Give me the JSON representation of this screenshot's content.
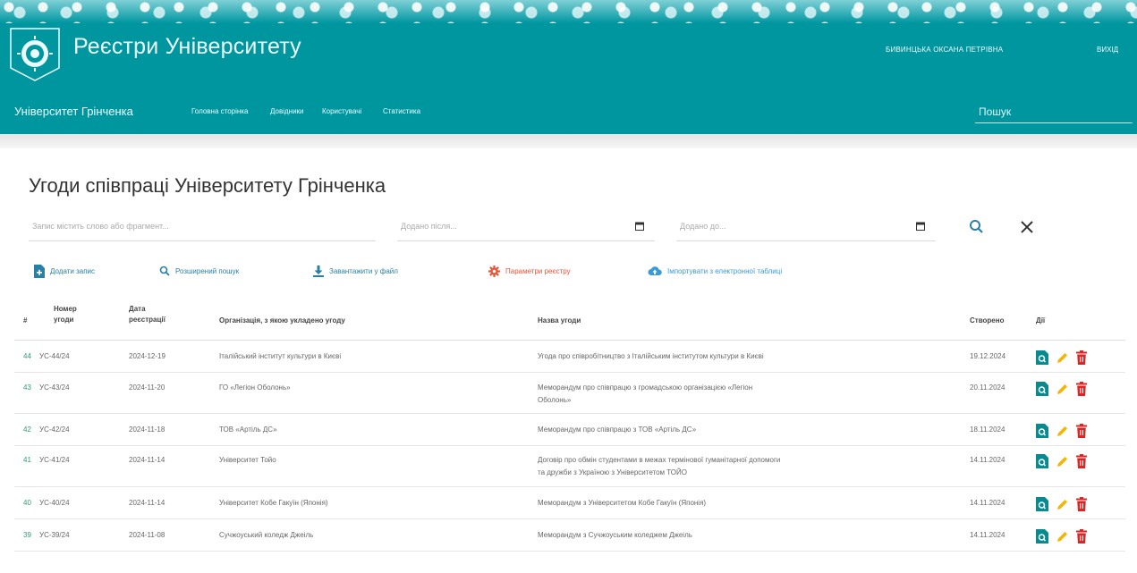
{
  "header": {
    "app_title": "Реєстри Університету",
    "user_name": "БИВИНЦЬКА ОКСАНА ПЕТРІВНА",
    "logout_label": "ВИХІД"
  },
  "nav": {
    "brand": "Університет Грінченка",
    "links": [
      "Головна сторінка",
      "Довідники",
      "Користувачі",
      "Статистика"
    ],
    "search_placeholder": "Пошук"
  },
  "page": {
    "title": "Угоди співпраці Університету Грінченка"
  },
  "filters": {
    "text_placeholder": "Запис містить слово або фрагмент...",
    "date_from_placeholder": "Додано після...",
    "date_to_placeholder": "Додано до..."
  },
  "toolbar": {
    "add_label": "Додати запис",
    "advanced_search_label": "Розширений пошук",
    "download_label": "Завантажити у файл",
    "settings_label": "Параметри реєстру",
    "import_label": "Імпортувати з електронної таблиці"
  },
  "colors": {
    "brand": "#0096a0",
    "add": "#2a7fa6",
    "search": "#2a7fa6",
    "download": "#2a7fa6",
    "settings": "#e8553a",
    "import": "#3a9ad9",
    "view_icon": "#0a8a8e",
    "edit_icon": "#f5b400",
    "delete_icon": "#e02424"
  },
  "table": {
    "columns": {
      "index": "#",
      "number_line1": "Номер",
      "number_line2": "угоди",
      "date_line1": "Дата",
      "date_line2": "реєстрації",
      "organization": "Організація, з якою укладено угоду",
      "name": "Назва угоди",
      "created": "Створено",
      "actions": "Дії"
    },
    "rows": [
      {
        "index": "44",
        "number": "УС-44/24",
        "date": "2024-12-19",
        "organization": "Італійський інститут культури в Києві",
        "name_line1": "Угода про співробітництво з Італійським інститутом культури в Києві",
        "name_line2": "",
        "created": "19.12.2024"
      },
      {
        "index": "43",
        "number": "УС-43/24",
        "date": "2024-11-20",
        "organization": "ГО «Легіон Оболонь»",
        "name_line1": "Меморандум про співпрацю з громадською організацією «Легіон",
        "name_line2": "Оболонь»",
        "created": "20.11.2024"
      },
      {
        "index": "42",
        "number": "УС-42/24",
        "date": "2024-11-18",
        "organization": "ТОВ «Артіль ДС»",
        "name_line1": "Меморандум про співпрацю з ТОВ «Артіль ДС»",
        "name_line2": "",
        "created": "18.11.2024"
      },
      {
        "index": "41",
        "number": "УС-41/24",
        "date": "2024-11-14",
        "organization": "Університет Тойо",
        "name_line1": "Договір про обмін студентами в межах термінової гуманітарної допомоги",
        "name_line2": "та дружби з Україною з Університетом ТОЙО",
        "created": "14.11.2024"
      },
      {
        "index": "40",
        "number": "УС-40/24",
        "date": "2024-11-14",
        "organization": "Університет Кобе Гакуїн (Японія)",
        "name_line1": "Меморандум з Університетом Кобе Гакуїн (Японія)",
        "name_line2": "",
        "created": "14.11.2024"
      },
      {
        "index": "39",
        "number": "УС-39/24",
        "date": "2024-11-08",
        "organization": "Сучжоуський коледж Джеіль",
        "name_line1": "Меморандум з Сучжоуським коледжем Джеіль",
        "name_line2": "",
        "created": "14.11.2024"
      }
    ]
  }
}
